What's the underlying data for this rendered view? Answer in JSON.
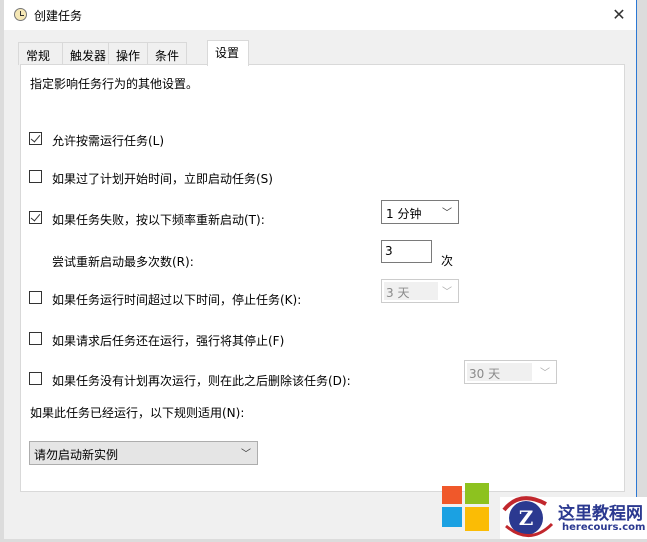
{
  "window": {
    "title": "创建任务",
    "close_icon": "close-icon"
  },
  "tabs": [
    {
      "label": "常规"
    },
    {
      "label": "触发器"
    },
    {
      "label": "操作"
    },
    {
      "label": "条件"
    },
    {
      "label": "设置",
      "active": true
    }
  ],
  "settings": {
    "description": "指定影响任务行为的其他设置。",
    "allow_on_demand": {
      "label": "允许按需运行任务(L)",
      "checked": true
    },
    "start_if_missed": {
      "label": "如果过了计划开始时间，立即启动任务(S)",
      "checked": false
    },
    "restart_on_failure": {
      "label": "如果任务失败，按以下频率重新启动(T):",
      "checked": true,
      "value": "1 分钟"
    },
    "restart_attempts": {
      "label": "尝试重新启动最多次数(R):",
      "value": "3",
      "unit": "次"
    },
    "stop_if_runs_longer": {
      "label": "如果任务运行时间超过以下时间，停止任务(K):",
      "checked": false,
      "value": "3 天"
    },
    "force_stop": {
      "label": "如果请求后任务还在运行，强行将其停止(F)",
      "checked": false
    },
    "delete_if_not_scheduled": {
      "label": "如果任务没有计划再次运行，则在此之后删除该任务(D):",
      "checked": false,
      "value": "30 天"
    },
    "if_running_rule": {
      "label": "如果此任务已经运行，以下规则适用(N):",
      "value": "请勿启动新实例"
    }
  },
  "watermark": {
    "title": "这里教程网",
    "url": "herecours.com"
  }
}
